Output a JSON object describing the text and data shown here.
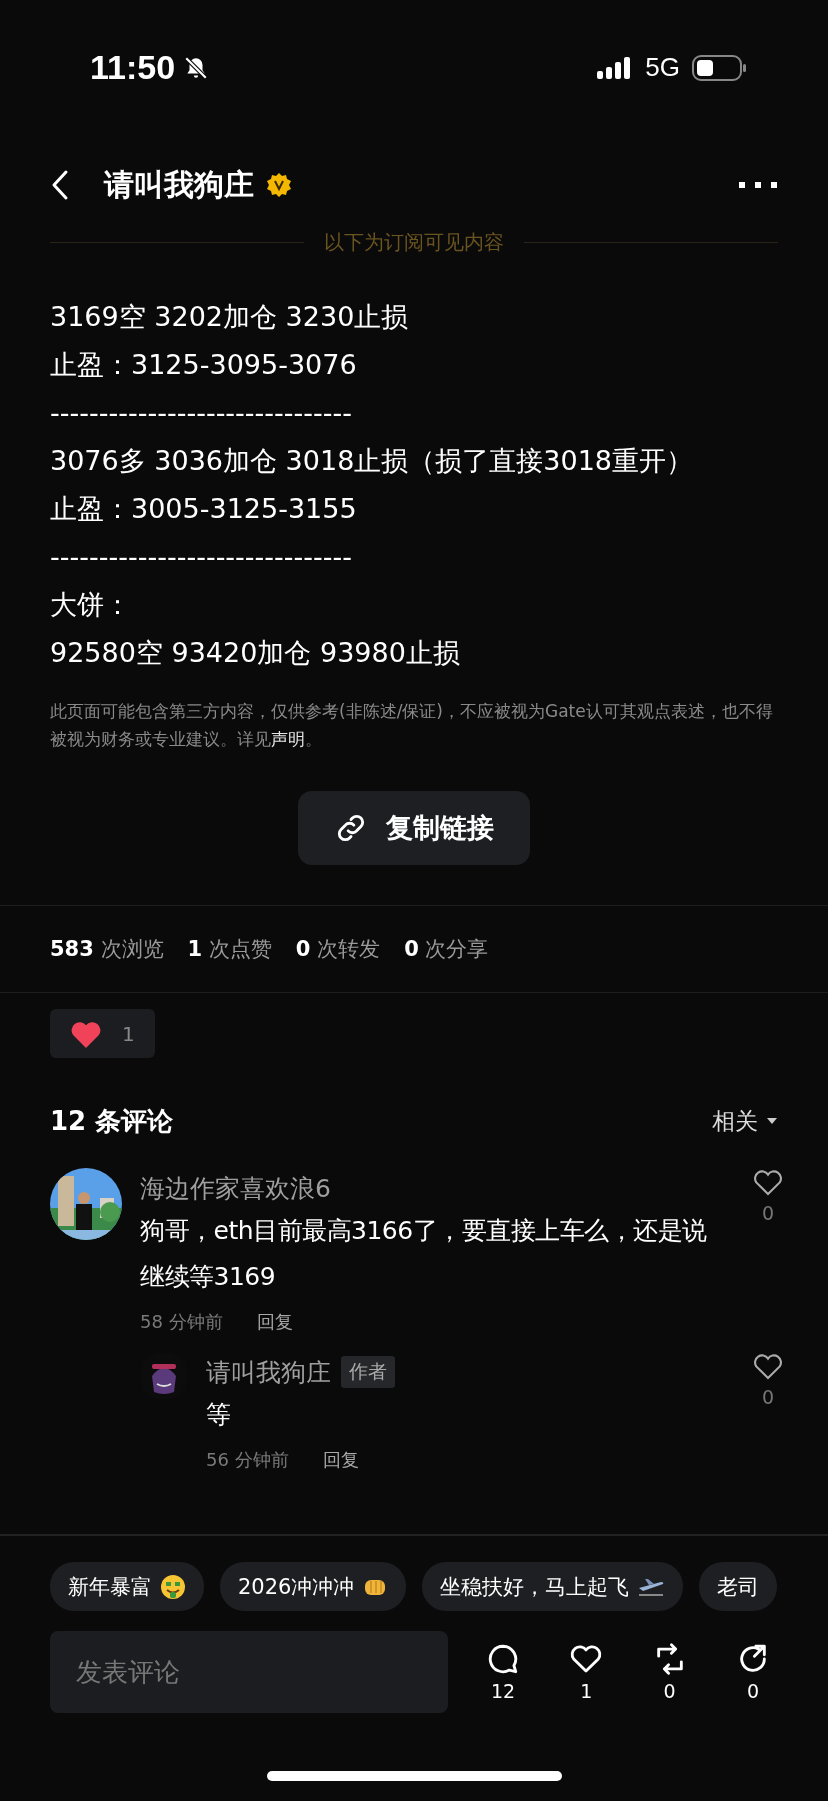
{
  "status_bar": {
    "time": "11:50",
    "network": "5G"
  },
  "header": {
    "title": "请叫我狗庄",
    "verified": true
  },
  "subscriber_divider": "以下为订阅可见内容",
  "post_lines": [
    "3169空 3202加仓 3230止损",
    "止盈：3125-3095-3076",
    "-------------------------------",
    "3076多 3036加仓 3018止损（损了直接3018重开）",
    "止盈：3005-3125-3155",
    "-------------------------------",
    "大饼：",
    "92580空  93420加仓 93980止损"
  ],
  "disclaimer": {
    "text": "此页面可能包含第三方内容，仅供参考(非陈述/保证)，不应被视为Gate认可其观点表述，也不得被视为财务或专业建议。详见",
    "link": "声明",
    "end": "。"
  },
  "copy_button": "复制链接",
  "stats": [
    "**583** 次浏览",
    "**1** 次点赞",
    "**0** 次转发",
    "**0** 次分享"
  ],
  "reaction": {
    "count": "1"
  },
  "comments_header": {
    "title": "12 条评论",
    "sort": "相关"
  },
  "comments": [
    {
      "author": "海边作家喜欢浪6",
      "text": "狗哥，eth目前最高3166了，要直接上车么，还是说继续等3169",
      "time": "58 分钟前",
      "reply": "回复",
      "likes": "0",
      "children": [
        {
          "author": "请叫我狗庄",
          "author_badge": "作者",
          "text": "等",
          "time": "56 分钟前",
          "reply": "回复",
          "likes": "0"
        }
      ]
    }
  ],
  "quick_replies": [
    {
      "text": "新年暴富"
    },
    {
      "text": "2026冲冲冲"
    },
    {
      "text": "坐稳扶好，马上起飞"
    },
    {
      "text": "老司"
    }
  ],
  "comment_input": {
    "placeholder": "发表评论"
  },
  "actions": [
    {
      "kind": "comment",
      "count": "12"
    },
    {
      "kind": "like",
      "count": "1"
    },
    {
      "kind": "repost",
      "count": "0"
    },
    {
      "kind": "share",
      "count": "0"
    }
  ]
}
